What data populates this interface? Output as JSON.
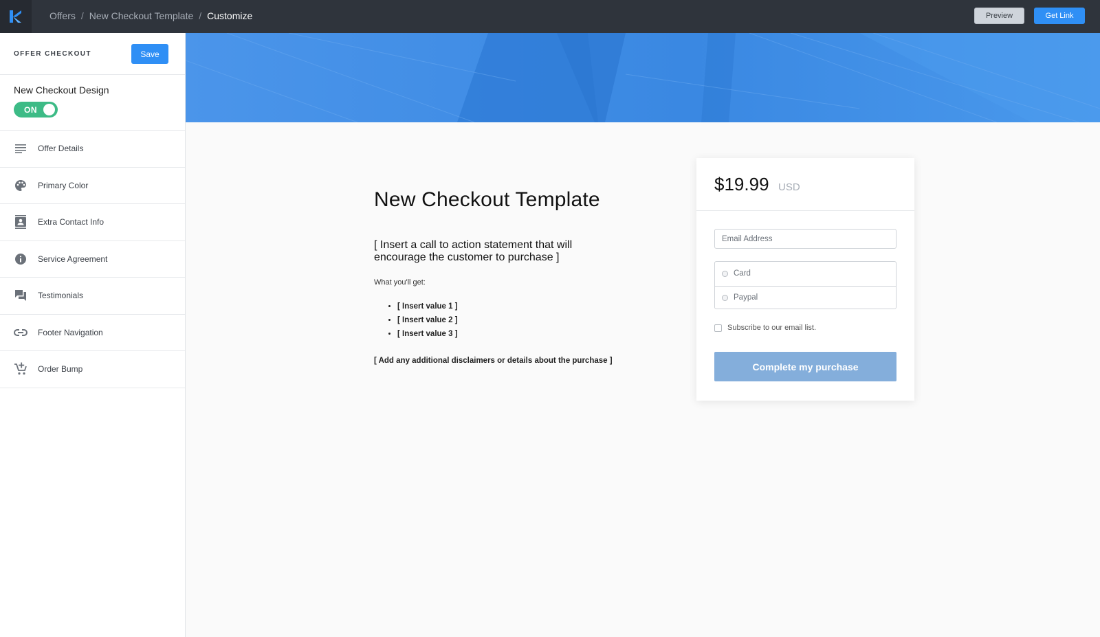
{
  "colors": {
    "topbar": "#2f343c",
    "accent": "#2f8ff5",
    "toggle_on": "#3dbb86",
    "banner": "#3f8ee6",
    "purchase_button": "#84aedb"
  },
  "topbar": {
    "logo_icon": "kajabi-logo-icon",
    "breadcrumbs": [
      "Offers",
      "New Checkout Template",
      "Customize"
    ],
    "separator": "/",
    "preview_label": "Preview",
    "get_link_label": "Get Link"
  },
  "sidebar": {
    "title": "OFFER CHECKOUT",
    "save_label": "Save",
    "design_label": "New Checkout Design",
    "toggle_label": "ON",
    "items": [
      {
        "label": "Offer Details",
        "icon": "lines-icon"
      },
      {
        "label": "Primary Color",
        "icon": "palette-icon"
      },
      {
        "label": "Extra Contact Info",
        "icon": "contact-card-icon"
      },
      {
        "label": "Service Agreement",
        "icon": "info-icon"
      },
      {
        "label": "Testimonials",
        "icon": "chat-icon"
      },
      {
        "label": "Footer Navigation",
        "icon": "link-icon"
      },
      {
        "label": "Order Bump",
        "icon": "cart-add-icon"
      }
    ]
  },
  "page": {
    "title": "New Checkout Template",
    "cta": "[ Insert a call to action statement that will encourage the customer to purchase ]",
    "get_label": "What you'll get:",
    "values": [
      "[ Insert value 1 ]",
      "[ Insert value 2 ]",
      "[ Insert value 3 ]"
    ],
    "disclaimer": "[ Add any additional disclaimers or details about the purchase ]"
  },
  "card": {
    "price": "$19.99",
    "currency": "USD",
    "email_placeholder": "Email Address",
    "payment_options": [
      "Card",
      "Paypal"
    ],
    "subscribe_label": "Subscribe to our email list.",
    "purchase_label": "Complete my purchase"
  }
}
